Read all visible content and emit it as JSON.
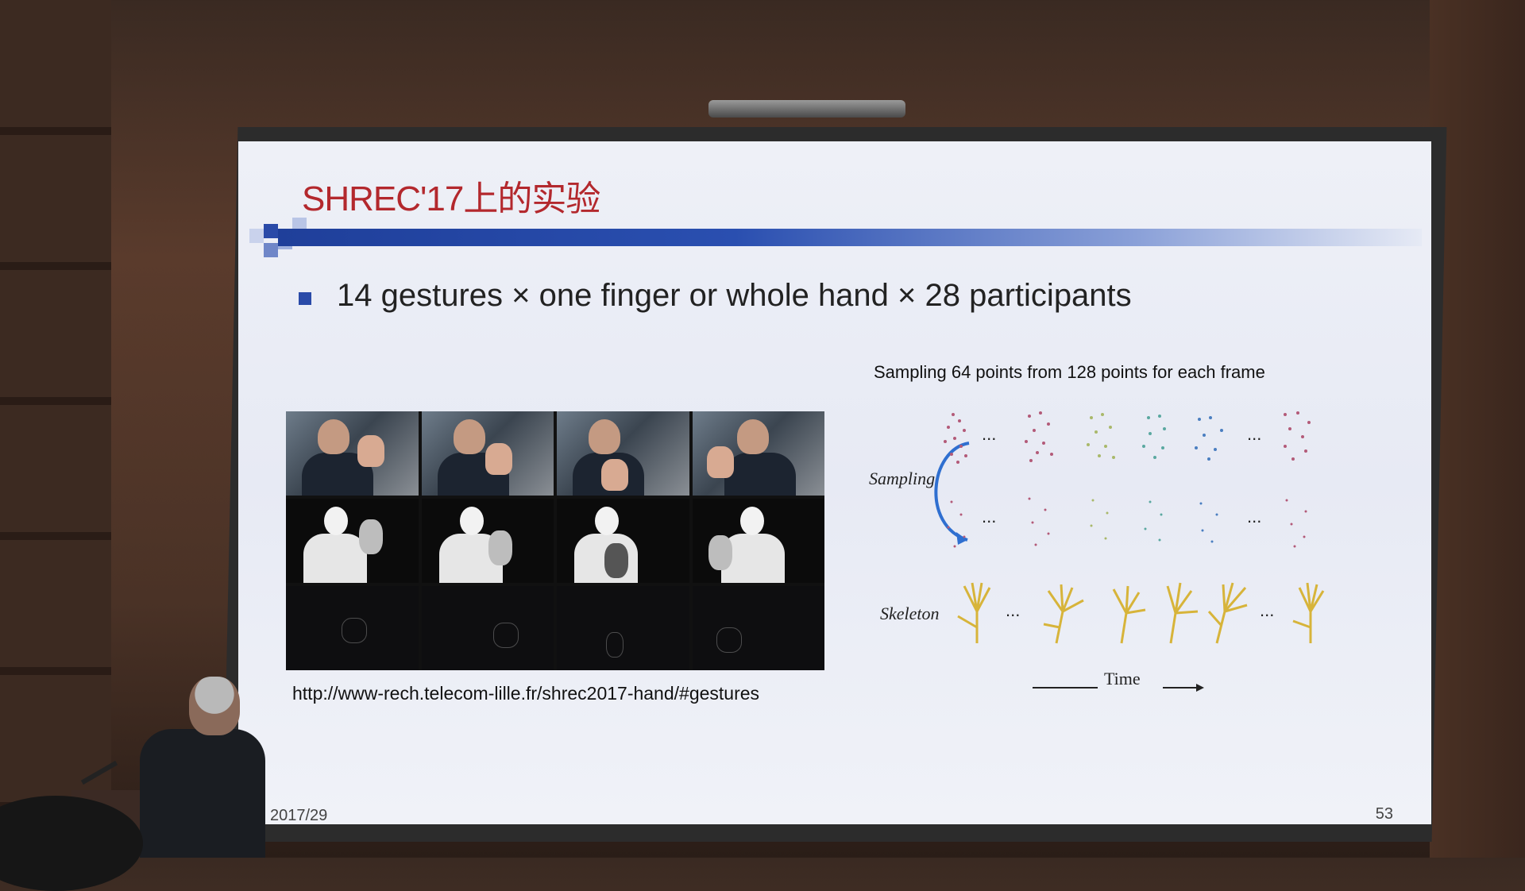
{
  "slide": {
    "title": "SHREC'17上的实验",
    "bullet": "14 gestures × one finger or whole hand × 28 participants",
    "url": "http://www-rech.telecom-lille.fr/shrec2017-hand/#gestures",
    "right_caption": "Sampling 64 points from 128 points for each frame",
    "sampling_label": "Sampling",
    "skeleton_label": "Skeleton",
    "time_label": "Time",
    "ellipsis": "...",
    "date": "2017/29",
    "page_number": "53"
  },
  "colors": {
    "title": "#b3282d",
    "accent_bar": "#1f3f9a",
    "bullet": "#2a4aa8",
    "arrow": "#2f6fd0",
    "skeleton": "#d7b43a"
  }
}
